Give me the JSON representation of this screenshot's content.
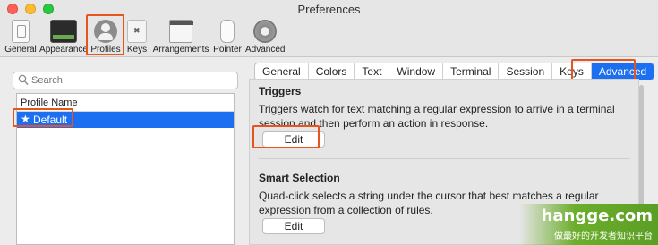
{
  "window": {
    "title": "Preferences"
  },
  "toolbar": {
    "items": [
      {
        "label": "General",
        "icon": "general-icon"
      },
      {
        "label": "Appearance",
        "icon": "appearance-icon"
      },
      {
        "label": "Profiles",
        "icon": "profiles-icon"
      },
      {
        "label": "Keys",
        "icon": "keys-icon"
      },
      {
        "label": "Arrangements",
        "icon": "arrangements-icon"
      },
      {
        "label": "Pointer",
        "icon": "pointer-icon"
      },
      {
        "label": "Advanced",
        "icon": "gear-icon"
      }
    ],
    "selected": "Profiles"
  },
  "sidebar": {
    "search_placeholder": "Search",
    "column_header": "Profile Name",
    "profiles": [
      {
        "label": "Default",
        "selected": true
      }
    ]
  },
  "tabs": {
    "items": [
      "General",
      "Colors",
      "Text",
      "Window",
      "Terminal",
      "Session",
      "Keys",
      "Advanced"
    ],
    "active": "Advanced"
  },
  "sections": {
    "triggers": {
      "title": "Triggers",
      "description": "Triggers watch for text matching a regular expression to arrive in a terminal session and then perform an action in response.",
      "button": "Edit"
    },
    "smart_selection": {
      "title": "Smart Selection",
      "description": "Quad-click selects a string under the cursor that best matches a regular expression from a collection of rules.",
      "button": "Edit"
    }
  },
  "watermark": {
    "main": "hangge.com",
    "sub": "做最好的开发者知识平台"
  },
  "colors": {
    "accent": "#1b6ff0",
    "highlight": "#e8541e",
    "background": "#ececec"
  }
}
